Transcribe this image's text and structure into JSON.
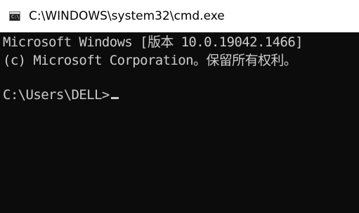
{
  "window": {
    "title": "C:\\WINDOWS\\system32\\cmd.exe",
    "icon": "cmd-icon"
  },
  "console": {
    "background": "#0c0c0c",
    "foreground": "#cccccc",
    "lines": [
      "Microsoft Windows [版本 10.0.19042.1466]",
      "(c) Microsoft Corporation。保留所有权利。",
      "",
      "C:\\Users\\DELL>"
    ]
  }
}
